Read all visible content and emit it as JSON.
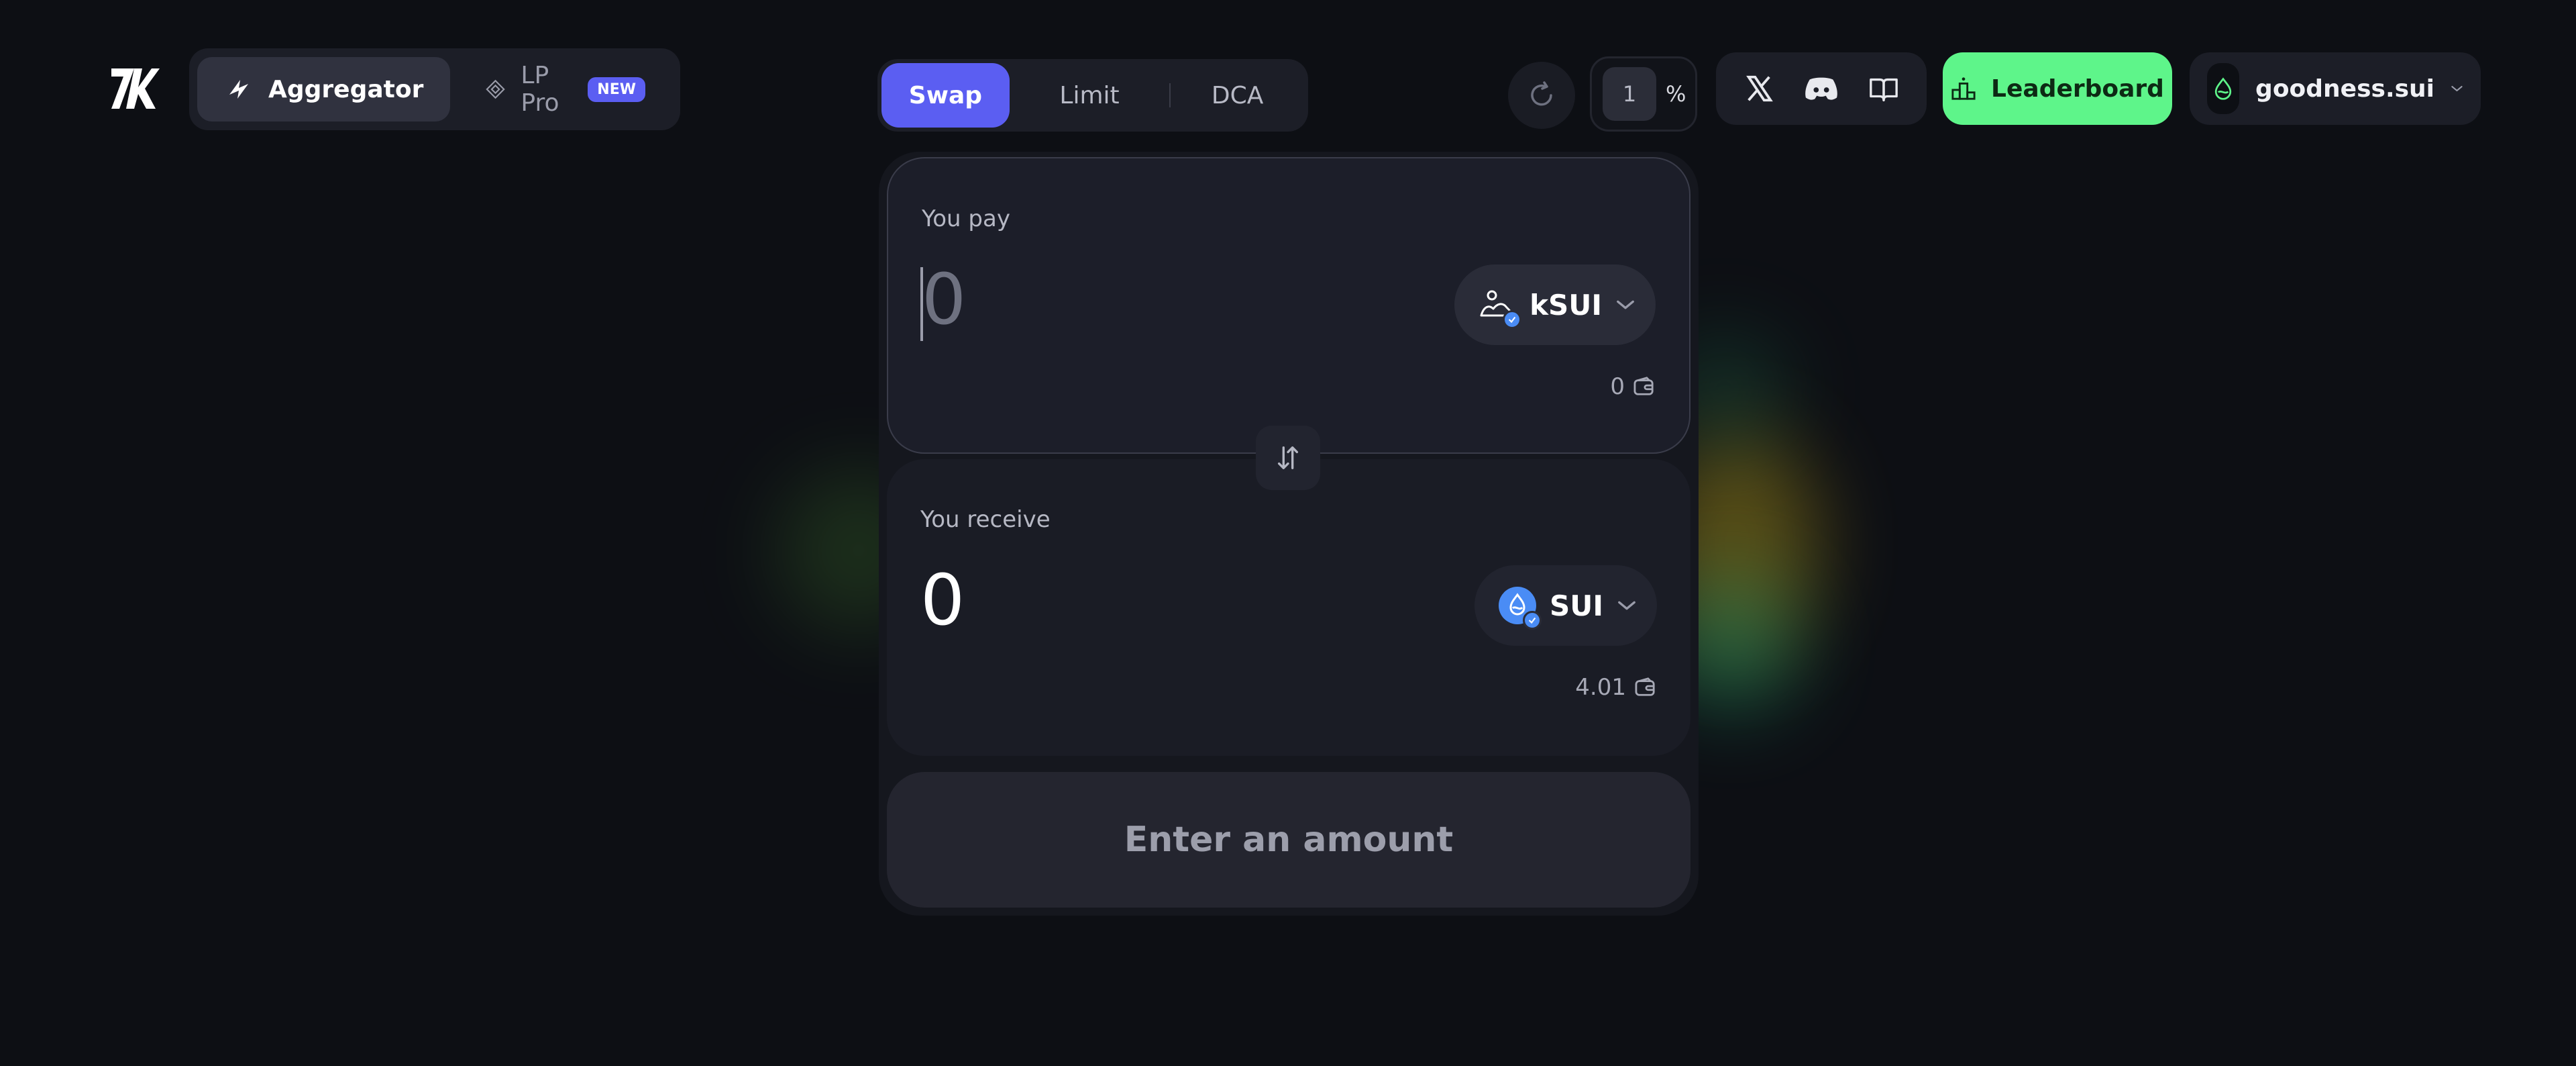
{
  "nav": {
    "logo_icon": "seven-k-logo",
    "modes": [
      {
        "label": "Aggregator",
        "icon": "aggregator-icon",
        "active": true
      },
      {
        "label": "LP Pro",
        "icon": "lp-pro-icon",
        "badge": "NEW",
        "active": false
      }
    ]
  },
  "tabs": [
    {
      "label": "Swap",
      "active": true
    },
    {
      "label": "Limit",
      "active": false
    },
    {
      "label": "DCA",
      "active": false
    }
  ],
  "controls": {
    "refresh_icon": "refresh-icon",
    "slippage_value": "1",
    "slippage_unit": "%"
  },
  "social": [
    "x-icon",
    "discord-icon",
    "docs-book-icon"
  ],
  "leaderboard": {
    "label": "Leaderboard",
    "icon": "podium-icon"
  },
  "wallet": {
    "name": "goodness.sui",
    "avatar_icon": "sui-drop-icon"
  },
  "swap": {
    "pay": {
      "label": "You pay",
      "amount": "0",
      "token": "kSUI",
      "token_icon": "ksui-icon",
      "balance": "0"
    },
    "receive": {
      "label": "You receive",
      "amount": "0",
      "token": "SUI",
      "token_icon": "sui-icon",
      "balance": "4.01"
    },
    "flip_icon": "swap-arrows-icon",
    "cta_label": "Enter an amount"
  },
  "colors": {
    "background": "#0d0f14",
    "accent": "#5b5ef2",
    "leaderboard_bg": "#5ef58a",
    "sui_blue": "#4a8cf5"
  }
}
